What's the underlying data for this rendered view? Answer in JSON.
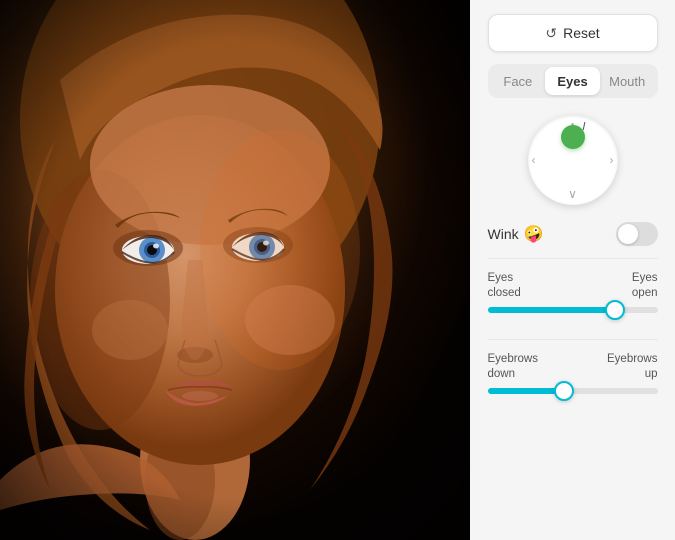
{
  "portrait": {
    "alt": "Portrait of a woman with blue eyes and blonde hair"
  },
  "controls": {
    "reset_label": "Reset",
    "tabs": [
      {
        "id": "face",
        "label": "Face",
        "active": false
      },
      {
        "id": "eyes",
        "label": "Eyes",
        "active": true
      },
      {
        "id": "mouth",
        "label": "Mouth",
        "active": false
      }
    ],
    "dial": {
      "arrows": {
        "top": "∧",
        "bottom": "∨",
        "left": "‹",
        "right": "›"
      }
    },
    "wink": {
      "label": "Wink",
      "emoji": "🤪",
      "enabled": false
    },
    "sliders": [
      {
        "id": "eyes-open",
        "label_left": "Eyes\nclosed",
        "label_right": "Eyes\nopen",
        "fill_pct": 75,
        "thumb_pct": 75
      },
      {
        "id": "eyebrows",
        "label_left": "Eyebrows\ndown",
        "label_right": "Eyebrows\nup",
        "fill_pct": 45,
        "thumb_pct": 45
      }
    ]
  }
}
